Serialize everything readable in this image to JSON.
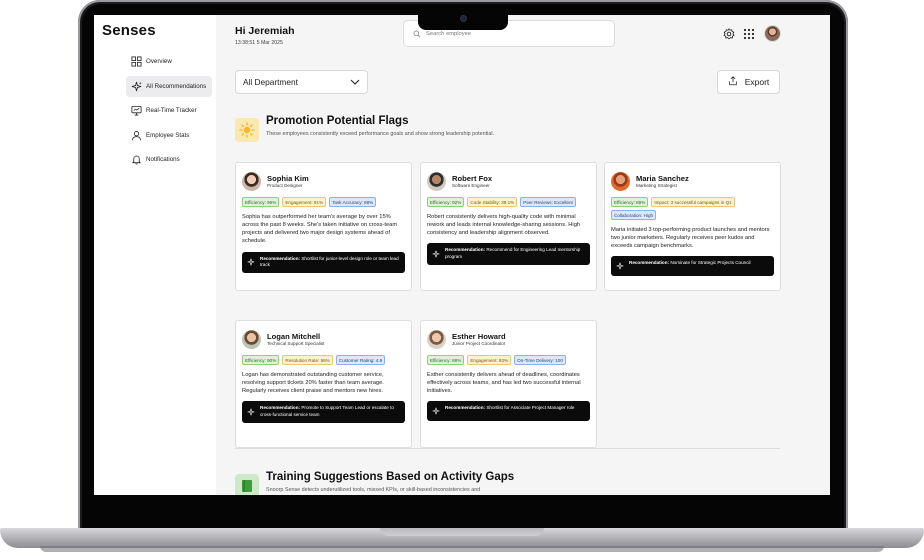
{
  "app": {
    "brand": "Senses"
  },
  "sidebar": {
    "items": [
      {
        "label": "Overview",
        "icon": "grid-icon"
      },
      {
        "label": "All Recommendations",
        "icon": "sparkle-icon"
      },
      {
        "label": "Real-Time Tracker",
        "icon": "monitor-icon"
      },
      {
        "label": "Employee Stats",
        "icon": "person-icon"
      },
      {
        "label": "Notifications",
        "icon": "bell-icon"
      }
    ],
    "active_index": 1
  },
  "header": {
    "greeting": "Hi Jeremiah",
    "datetime": "13:38:51 5 Mar 2025",
    "search_placeholder": "Search employee"
  },
  "controls": {
    "department": "All Department",
    "export_label": "Export"
  },
  "promotion": {
    "title": "Promotion Potential Flags",
    "description": "These employees consistently exceed performance goals and show strong leadership potential.",
    "cards": [
      {
        "name": "Sophia Kim",
        "role": "Product Designer",
        "badges": [
          {
            "text": "Efficiency: 96%",
            "color": "green"
          },
          {
            "text": "Engagement: 91%",
            "color": "yellow"
          },
          {
            "text": "Task Accuracy: 98%",
            "color": "blue"
          }
        ],
        "summary": "Sophia has outperformed her team's average by over 15% across the past 8 weeks. She's taken initiative on cross-team projects and delivered two major design systems ahead of schedule.",
        "rec_label": "Recommendation:",
        "rec_text": "Shortlist for junior-level design role or team lead track"
      },
      {
        "name": "Robert Fox",
        "role": "Software Engineer",
        "badges": [
          {
            "text": "Efficiency: 92%",
            "color": "green"
          },
          {
            "text": "Code Stability: 39.1%",
            "color": "yellow"
          },
          {
            "text": "Peer Reviews: Excellent",
            "color": "blue"
          }
        ],
        "summary": "Robert consistently delivers high-quality code with minimal rework and leads internal knowledge-sharing sessions. High consistency and leadership alignment observed.",
        "rec_label": "Recommendation:",
        "rec_text": "Recommend for Engineering Lead mentorship program"
      },
      {
        "name": "Maria Sanchez",
        "role": "Marketing Strategist",
        "badges": [
          {
            "text": "Efficiency: 89%",
            "color": "green"
          },
          {
            "text": "Impact: 3 successful campaigns in Q1",
            "color": "yellow"
          },
          {
            "text": "Collaboration: High",
            "color": "blue"
          }
        ],
        "summary": "Maria initiated 3 top-performing product launches and mentors two junior marketers. Regularly receives peer kudos and exceeds campaign benchmarks.",
        "rec_label": "Recommendation:",
        "rec_text": "Nominate for Strategic Projects Council"
      },
      {
        "name": "Logan Mitchell",
        "role": "Technical Support Specialist",
        "badges": [
          {
            "text": "Efficiency: 90%",
            "color": "green"
          },
          {
            "text": "Resolution Rate: 96%",
            "color": "yellow"
          },
          {
            "text": "Customer Rating: 4.9",
            "color": "blue"
          }
        ],
        "summary": "Logan has demonstrated outstanding customer service, resolving support tickets 20% faster than team average. Regularly receives client praise and mentors new hires.",
        "rec_label": "Recommendation:",
        "rec_text": "Promote to Support Team Lead or escalate to cross-functional service team"
      },
      {
        "name": "Esther Howard",
        "role": "Junior Project Coordinator",
        "badges": [
          {
            "text": "Efficiency: 88%",
            "color": "green"
          },
          {
            "text": "Engagement: 93%",
            "color": "yellow"
          },
          {
            "text": "On-Time Delivery: 100",
            "color": "blue"
          }
        ],
        "summary": "Esther consistently delivers ahead of deadlines, coordinates effectively across teams, and has led two successful internal initiatives.",
        "rec_label": "Recommendation:",
        "rec_text": "Shortlist for Associate Project Manager role"
      }
    ]
  },
  "training": {
    "title": "Training Suggestions Based on Activity Gaps",
    "description": "Snoorp Sense detects underutilized tools, missed KPIs, or skill-based inconsistencies and"
  },
  "colors": {
    "accent_dark": "#0b0b0b",
    "badge_green": "#dcf3d6",
    "badge_yellow": "#fdf1cf",
    "badge_blue": "#dbe8fb",
    "promo_icon_bg": "#fbe7b0",
    "training_icon_bg": "#cfe9c8"
  }
}
